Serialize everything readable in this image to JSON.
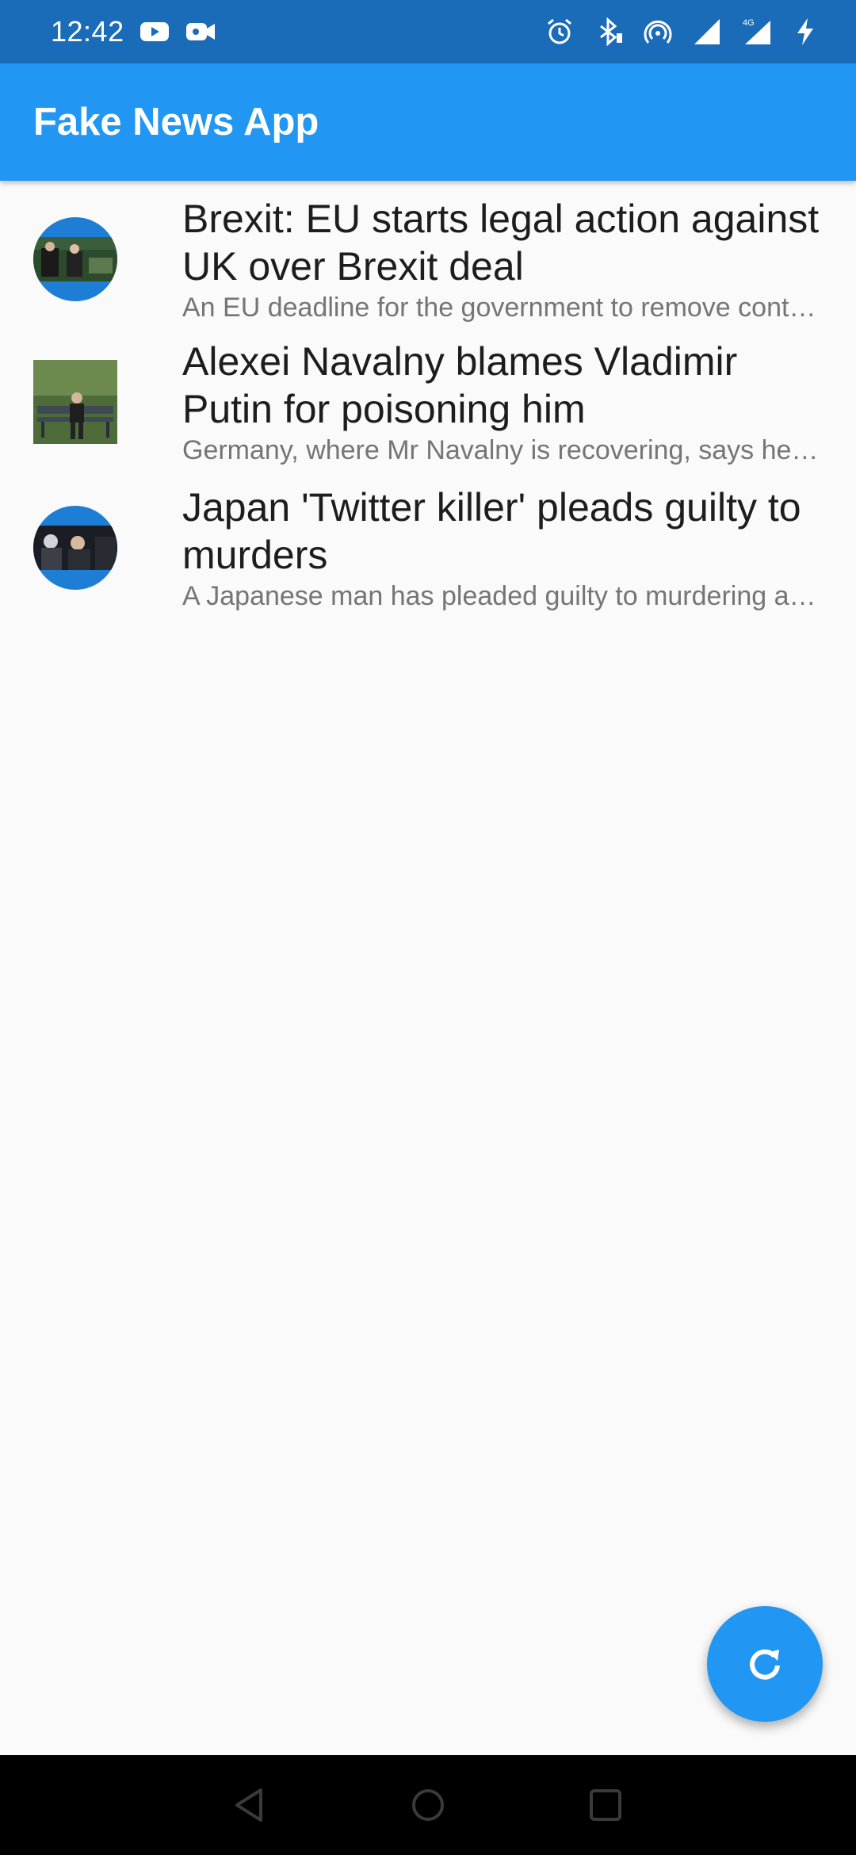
{
  "status_bar": {
    "time": "12:42",
    "left_icons": [
      "youtube-icon",
      "video-camera-icon"
    ],
    "right_icons": [
      "alarm-icon",
      "bluetooth-icon",
      "hotspot-icon",
      "signal-icon",
      "signal-4g-icon",
      "charging-icon"
    ],
    "network_label": "4G"
  },
  "app_bar": {
    "title": "Fake News App"
  },
  "news": [
    {
      "title": "Brexit: EU starts legal action against UK over Brexit deal",
      "description": "An EU deadline for the government to remove contentious parts of its Internal Market Bill has passed.",
      "thumb_shape": "circle"
    },
    {
      "title": "Alexei Navalny blames Vladimir Putin for poisoning him",
      "description": "Germany, where Mr Navalny is recovering, says he was poisoned with a Novichok nerve agent.",
      "thumb_shape": "square"
    },
    {
      "title": "Japan 'Twitter killer' pleads guilty to murders",
      "description": "A Japanese man has pleaded guilty to murdering and dismembering nine people.",
      "thumb_shape": "circle"
    }
  ],
  "fab": {
    "icon": "refresh-icon"
  },
  "nav_bar": {
    "buttons": [
      "back-icon",
      "home-icon",
      "recents-icon"
    ]
  },
  "colors": {
    "primary": "#2196f3",
    "status_bar": "#1b6cb8",
    "background": "#fafafa"
  }
}
